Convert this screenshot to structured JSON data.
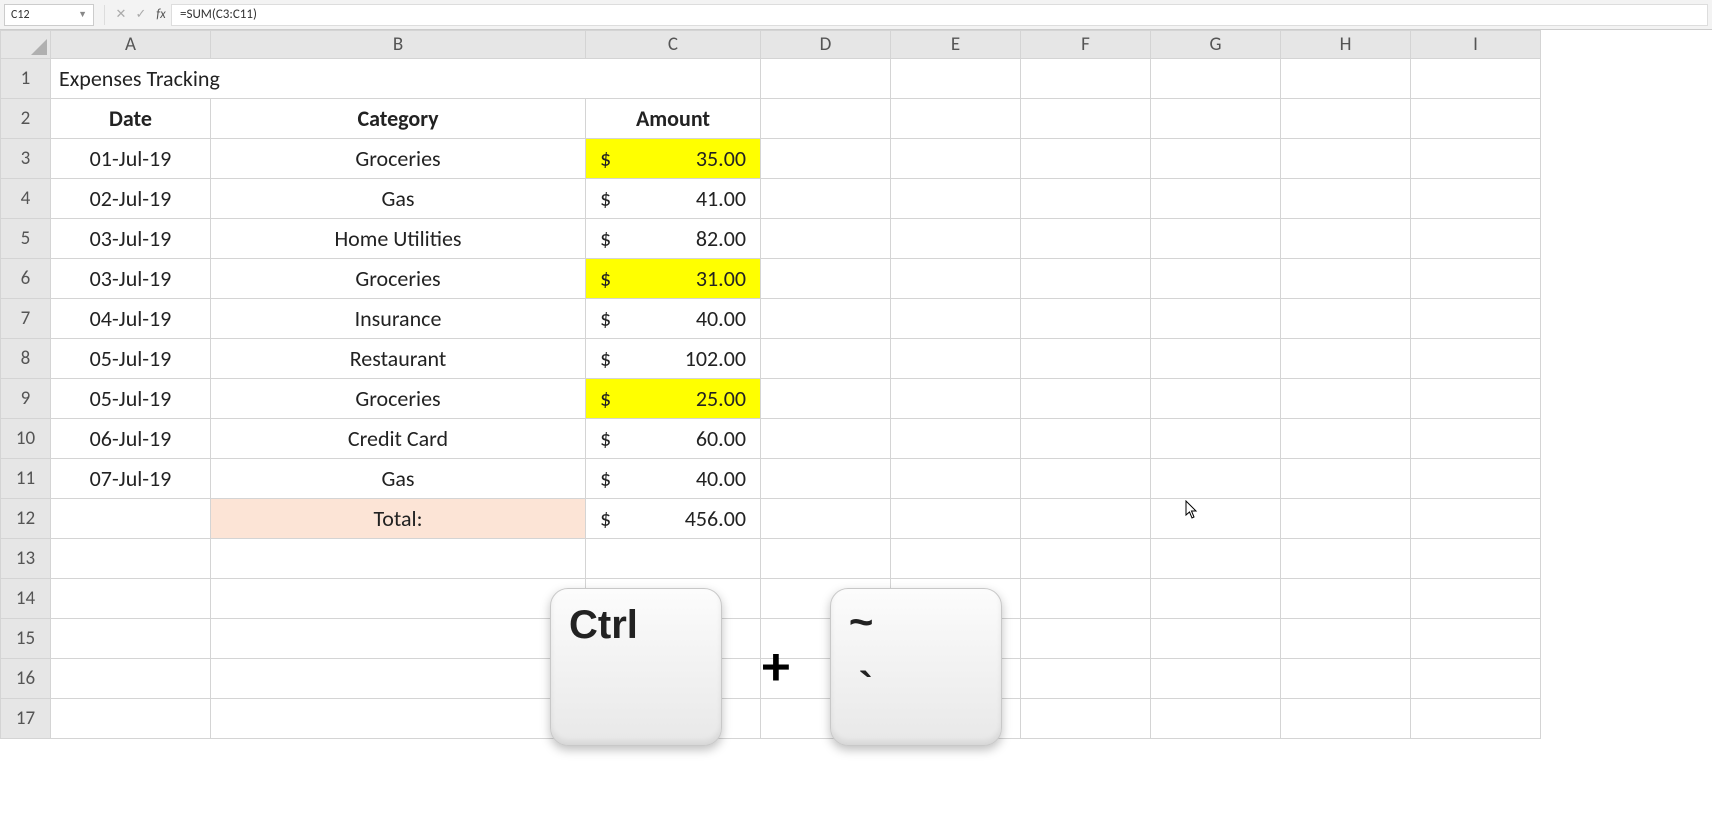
{
  "formula_bar": {
    "name_box": "C12",
    "formula": "=SUM(C3:C11)"
  },
  "columns": [
    "A",
    "B",
    "C",
    "D",
    "E",
    "F",
    "G",
    "H",
    "I"
  ],
  "rows_visible": 17,
  "sheet": {
    "title": "Expenses Tracking",
    "headers": {
      "date": "Date",
      "category": "Category",
      "amount": "Amount"
    },
    "currency_symbol": "$",
    "rows": [
      {
        "date": "01-Jul-19",
        "category": "Groceries",
        "amount": "35.00",
        "highlight": true
      },
      {
        "date": "02-Jul-19",
        "category": "Gas",
        "amount": "41.00",
        "highlight": false
      },
      {
        "date": "03-Jul-19",
        "category": "Home Utilities",
        "amount": "82.00",
        "highlight": false
      },
      {
        "date": "03-Jul-19",
        "category": "Groceries",
        "amount": "31.00",
        "highlight": true
      },
      {
        "date": "04-Jul-19",
        "category": "Insurance",
        "amount": "40.00",
        "highlight": false
      },
      {
        "date": "05-Jul-19",
        "category": "Restaurant",
        "amount": "102.00",
        "highlight": false
      },
      {
        "date": "05-Jul-19",
        "category": "Groceries",
        "amount": "25.00",
        "highlight": true
      },
      {
        "date": "06-Jul-19",
        "category": "Credit Card",
        "amount": "60.00",
        "highlight": false
      },
      {
        "date": "07-Jul-19",
        "category": "Gas",
        "amount": "40.00",
        "highlight": false
      }
    ],
    "total_label": "Total:",
    "total_amount": "456.00"
  },
  "overlay": {
    "key1": "Ctrl",
    "plus": "+",
    "key2_top": "~",
    "key2_bottom": "`"
  }
}
